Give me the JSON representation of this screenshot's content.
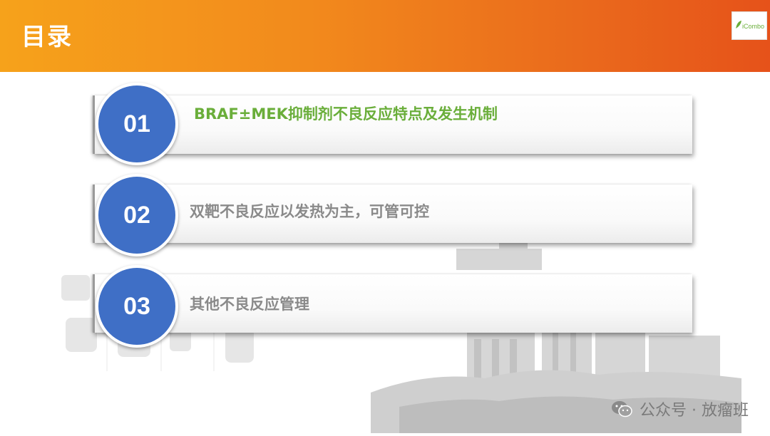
{
  "header": {
    "title": "目录"
  },
  "logo": {
    "name": "iCombo"
  },
  "items": [
    {
      "number": "01",
      "label": "BRAF±MEK抑制剂不良反应特点及发生机制",
      "active": true
    },
    {
      "number": "02",
      "label": "双靶不良反应以发热为主，可管可控",
      "active": false
    },
    {
      "number": "03",
      "label": "其他不良反应管理",
      "active": false
    }
  ],
  "watermark": {
    "text": "公众号 · 放瘤班"
  },
  "colors": {
    "header_start": "#f6a21b",
    "header_end": "#e6521a",
    "circle": "#3f6fc6",
    "active_text": "#6aae3a",
    "muted_text": "#8a8a8a"
  }
}
